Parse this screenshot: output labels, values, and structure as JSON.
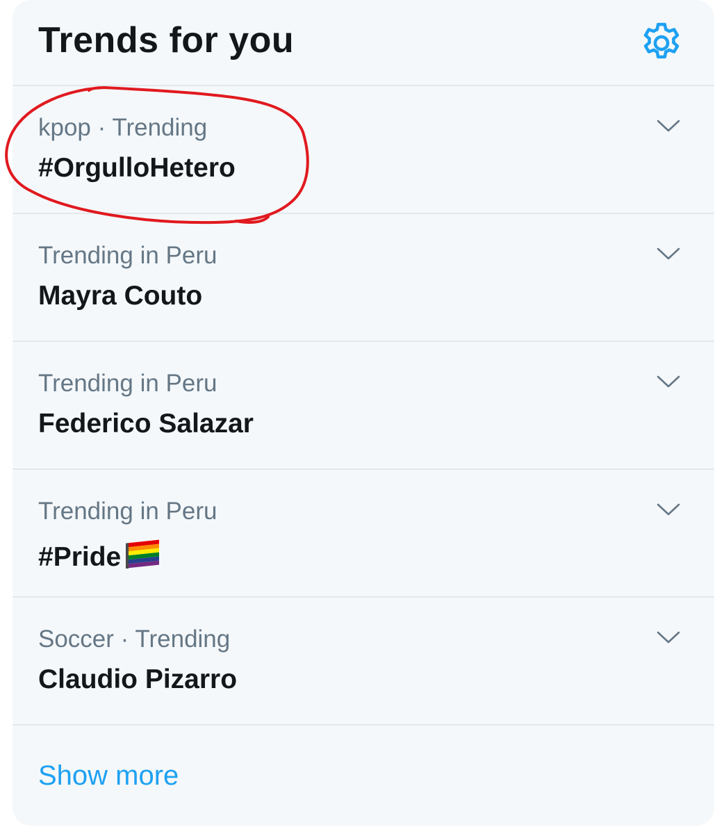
{
  "header": {
    "title": "Trends for you",
    "settings_icon": "gear-icon"
  },
  "trends": [
    {
      "context": "kpop · Trending",
      "name": "#OrgulloHetero"
    },
    {
      "context": "Trending in Peru",
      "name": "Mayra Couto"
    },
    {
      "context": "Trending in Peru",
      "name": "Federico Salazar"
    },
    {
      "context": "Trending in Peru",
      "name": "#Pride",
      "emoji": "rainbow-flag-icon"
    },
    {
      "context": "Soccer · Trending",
      "name": "Claudio Pizarro"
    }
  ],
  "footer": {
    "show_more": "Show more"
  },
  "colors": {
    "accent": "#1da1f2",
    "panel_bg": "#f5f8fa",
    "secondary_text": "#657786",
    "primary_text": "#14171a",
    "annotation": "#e0191f"
  }
}
